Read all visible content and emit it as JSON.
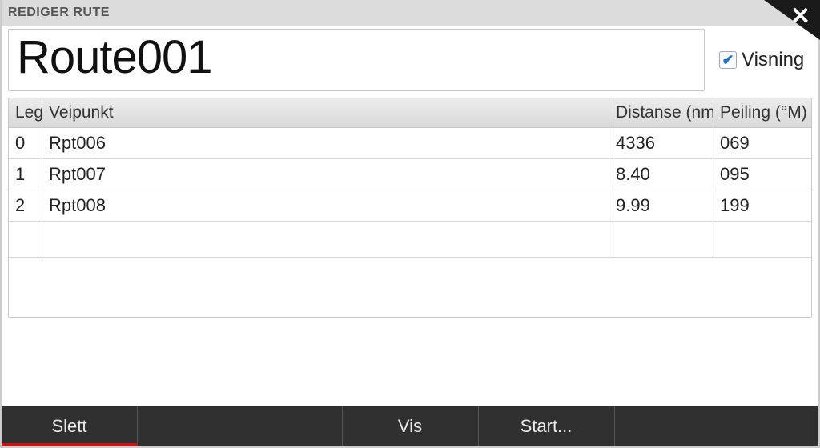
{
  "window": {
    "title": "REDIGER RUTE"
  },
  "route": {
    "name": "Route001",
    "display_label": "Visning",
    "display_checked": true
  },
  "table": {
    "headers": {
      "leg": "Leg",
      "waypoint": "Veipunkt",
      "distance": "Distanse (nm)",
      "bearing": "Peiling (°M)"
    },
    "rows": [
      {
        "leg": "0",
        "waypoint": "Rpt006",
        "distance": "4336",
        "bearing": "069"
      },
      {
        "leg": "1",
        "waypoint": "Rpt007",
        "distance": "8.40",
        "bearing": "095"
      },
      {
        "leg": "2",
        "waypoint": "Rpt008",
        "distance": "9.99",
        "bearing": "199"
      }
    ]
  },
  "bottombar": {
    "delete": "Slett",
    "show": "Vis",
    "start": "Start..."
  }
}
